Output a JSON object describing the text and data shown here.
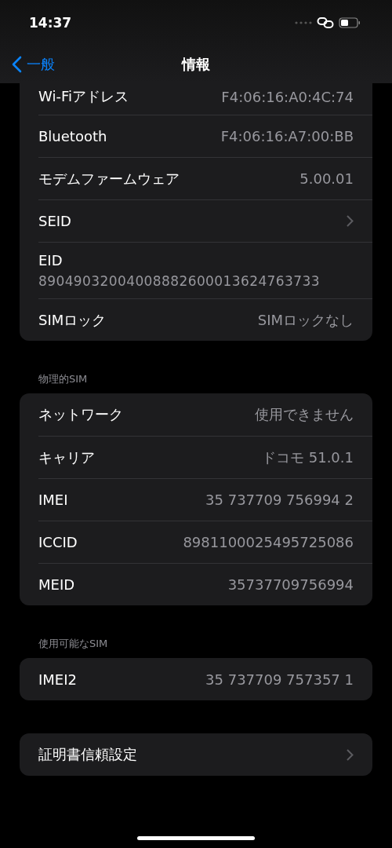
{
  "status_bar": {
    "time": "14:37"
  },
  "nav": {
    "back_label": "一般",
    "title": "情報"
  },
  "sections": [
    {
      "rows": [
        {
          "kind": "value",
          "label": "Wi-Fiアドレス",
          "value": "F4:06:16:A0:4C:74"
        },
        {
          "kind": "value",
          "label": "Bluetooth",
          "value": "F4:06:16:A7:00:BB"
        },
        {
          "kind": "value",
          "label": "モデムファームウェア",
          "value": "5.00.01"
        },
        {
          "kind": "chevron",
          "label": "SEID"
        },
        {
          "kind": "stacked",
          "label": "EID",
          "value": "89049032004008882600013624763733"
        },
        {
          "kind": "value",
          "label": "SIMロック",
          "value": "SIMロックなし"
        }
      ]
    },
    {
      "header": "物理的SIM",
      "rows": [
        {
          "kind": "value",
          "label": "ネットワーク",
          "value": "使用できません"
        },
        {
          "kind": "value",
          "label": "キャリア",
          "value": "ドコモ 51.0.1"
        },
        {
          "kind": "value",
          "label": "IMEI",
          "value": "35 737709 756994 2"
        },
        {
          "kind": "value",
          "label": "ICCID",
          "value": "8981100025495725086"
        },
        {
          "kind": "value",
          "label": "MEID",
          "value": "35737709756994"
        }
      ]
    },
    {
      "header": "使用可能なSIM",
      "rows": [
        {
          "kind": "value",
          "label": "IMEI2",
          "value": "35 737709 757357 1"
        }
      ]
    },
    {
      "rows": [
        {
          "kind": "chevron",
          "label": "証明書信頼設定"
        }
      ]
    }
  ]
}
